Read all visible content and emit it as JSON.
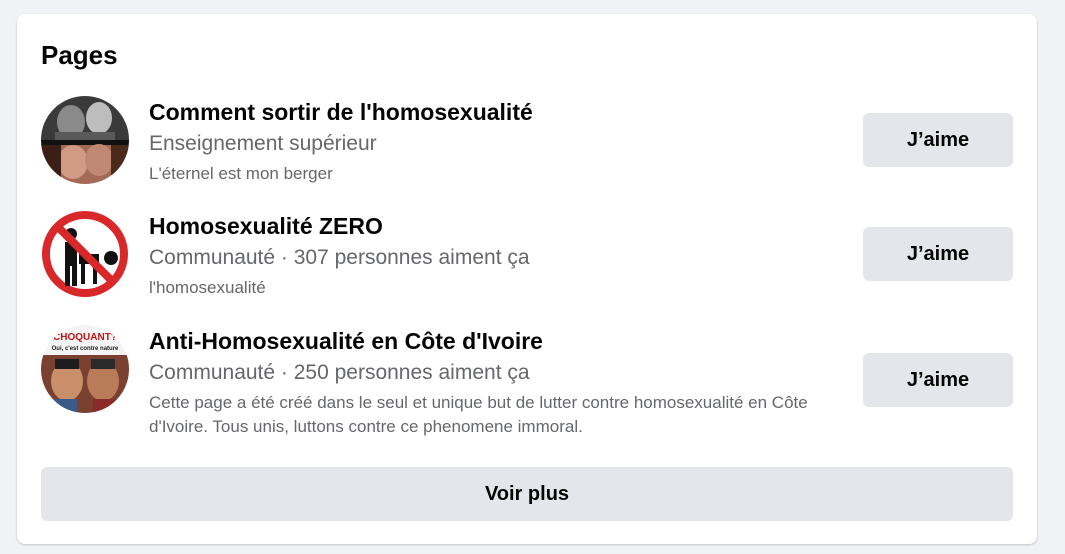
{
  "section": {
    "title": "Pages"
  },
  "pages": [
    {
      "name": "Comment sortir de l'homosexualité",
      "meta": "Enseignement supérieur",
      "description": "L'éternel est mon berger",
      "like_label": "J’aime",
      "avatar_icon": "photo-collage-avatar"
    },
    {
      "name": "Homosexualité ZERO",
      "meta": "Communauté · 307 personnes aiment ça",
      "description": "l'homosexualité",
      "like_label": "J’aime",
      "avatar_icon": "prohibition-sign-avatar"
    },
    {
      "name": "Anti-Homosexualité en Côte d'Ivoire",
      "meta": "Communauté · 250 personnes aiment ça",
      "description": "Cette page a été créé dans le seul et unique but de lutter contre homosexualité en Côte d'Ivoire. Tous unis, luttons contre ce phenomene immoral.",
      "like_label": "J’aime",
      "avatar_icon": "poster-avatar",
      "avatar_text": {
        "headline": "CHOQUANT?",
        "subline": "Oui, c'est contre nature"
      }
    }
  ],
  "footer": {
    "more_label": "Voir plus"
  },
  "colors": {
    "background": "#f0f2f5",
    "card": "#ffffff",
    "button": "#e4e6eb",
    "secondary_text": "#65676b",
    "prohibition_red": "#d8282a"
  }
}
